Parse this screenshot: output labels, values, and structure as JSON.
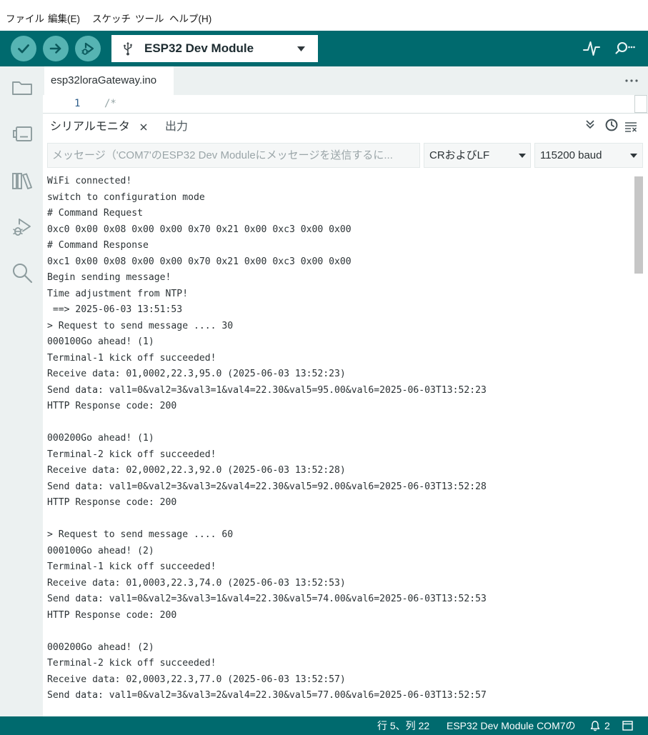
{
  "menu": {
    "items": [
      "ファイル",
      "編集(E)",
      "スケッチ",
      "ツール",
      "ヘルプ(H)"
    ]
  },
  "toolbar": {
    "board_name": "ESP32 Dev Module"
  },
  "editor": {
    "tab_name": "esp32loraGateway.ino",
    "lines": [
      {
        "number": "1",
        "code": "/*"
      }
    ]
  },
  "panel": {
    "tabs": [
      {
        "label": "シリアルモニタ",
        "active": true
      },
      {
        "label": "出力",
        "active": false
      }
    ],
    "message_placeholder": "メッセージ（'COM7'のESP32 Dev Moduleにメッセージを送信するに...",
    "line_ending": "CRおよびLF",
    "baud_rate": "115200 baud",
    "output_lines": [
      "WiFi connected!",
      "switch to configuration mode",
      "# Command Request",
      "0xc0 0x00 0x08 0x00 0x00 0x70 0x21 0x00 0xc3 0x00 0x00",
      "# Command Response",
      "0xc1 0x00 0x08 0x00 0x00 0x70 0x21 0x00 0xc3 0x00 0x00",
      "Begin sending message!",
      "Time adjustment from NTP!",
      " ==> 2025-06-03 13:51:53",
      "> Request to send message .... 30",
      "000100Go ahead! (1)",
      "Terminal-1 kick off succeeded!",
      "Receive data: 01,0002,22.3,95.0 (2025-06-03 13:52:23)",
      "Send data: val1=0&val2=3&val3=1&val4=22.30&val5=95.00&val6=2025-06-03T13:52:23",
      "HTTP Response code: 200",
      "",
      "000200Go ahead! (1)",
      "Terminal-2 kick off succeeded!",
      "Receive data: 02,0002,22.3,92.0 (2025-06-03 13:52:28)",
      "Send data: val1=0&val2=3&val3=2&val4=22.30&val5=92.00&val6=2025-06-03T13:52:28",
      "HTTP Response code: 200",
      "",
      "> Request to send message .... 60",
      "000100Go ahead! (2)",
      "Terminal-1 kick off succeeded!",
      "Receive data: 01,0003,22.3,74.0 (2025-06-03 13:52:53)",
      "Send data: val1=0&val2=3&val3=1&val4=22.30&val5=74.00&val6=2025-06-03T13:52:53",
      "HTTP Response code: 200",
      "",
      "000200Go ahead! (2)",
      "Terminal-2 kick off succeeded!",
      "Receive data: 02,0003,22.3,77.0 (2025-06-03 13:52:57)",
      "Send data: val1=0&val2=3&val3=2&val4=22.30&val5=77.00&val6=2025-06-03T13:52:57"
    ]
  },
  "status_bar": {
    "cursor_position": "行 5、列 22",
    "board_port": "ESP32 Dev Module COM7の",
    "notification_count": "2"
  },
  "icons": {
    "verify": "checkmark-icon",
    "upload": "arrow-right-icon",
    "debug": "debug-icon",
    "board_port": "usb-icon",
    "board_dropdown": "caret-down-icon",
    "serial_plotter": "serial-plotter-icon",
    "serial_monitor": "serial-monitor-icon",
    "sidebar": [
      "folder-icon",
      "board-icon",
      "library-icon",
      "debug-icon",
      "search-icon"
    ],
    "tab_more": "ellipsis-icon",
    "tab_close": "close-icon",
    "autoscroll": "double-chevron-down-icon",
    "timestamp": "clock-icon",
    "clear_output": "clear-icon",
    "notifications": "bell-icon",
    "layout": "window-icon"
  },
  "colors": {
    "toolbar": "#006a6e",
    "status_bar": "#006a6e",
    "toolbar_button": "#56b4b3",
    "sidebar": "#ecf1f1",
    "text": "#2b3235"
  }
}
